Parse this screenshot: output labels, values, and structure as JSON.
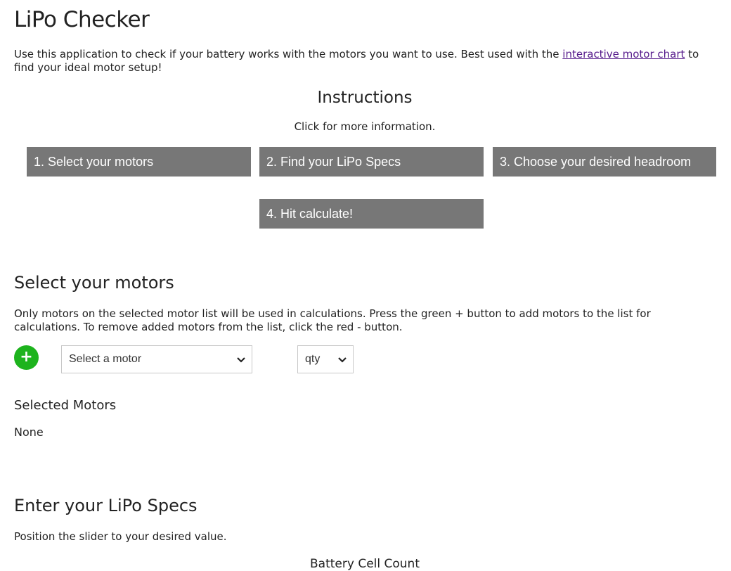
{
  "app": {
    "title": "LiPo Checker"
  },
  "intro": {
    "text_before": "Use this application to check if your battery works with the motors you want to use. Best used with the ",
    "link_text": "interactive motor chart",
    "text_after": " to find your ideal motor setup!"
  },
  "instructions": {
    "title": "Instructions",
    "subtitle": "Click for more information.",
    "steps": [
      {
        "label": "1. Select your motors"
      },
      {
        "label": "2. Find your LiPo Specs"
      },
      {
        "label": "3. Choose your desired headroom"
      },
      {
        "label": "4. Hit calculate!"
      }
    ]
  },
  "motors": {
    "title": "Select your motors",
    "description": "Only motors on the selected motor list will be used in calculations. Press the green + button to add motors to the list for calculations. To remove added motors from the list, click the red - button.",
    "add_button": "+",
    "motor_select_value": "Select a motor",
    "qty_select_value": "qty",
    "selected_title": "Selected Motors",
    "selected_value": "None"
  },
  "lipo": {
    "title": "Enter your LiPo Specs",
    "description": "Position the slider to your desired value.",
    "cell_count_label": "Battery Cell Count"
  },
  "colors": {
    "step_button_bg": "#777777",
    "add_button_bg": "#1db31d",
    "link": "#551a8b"
  }
}
